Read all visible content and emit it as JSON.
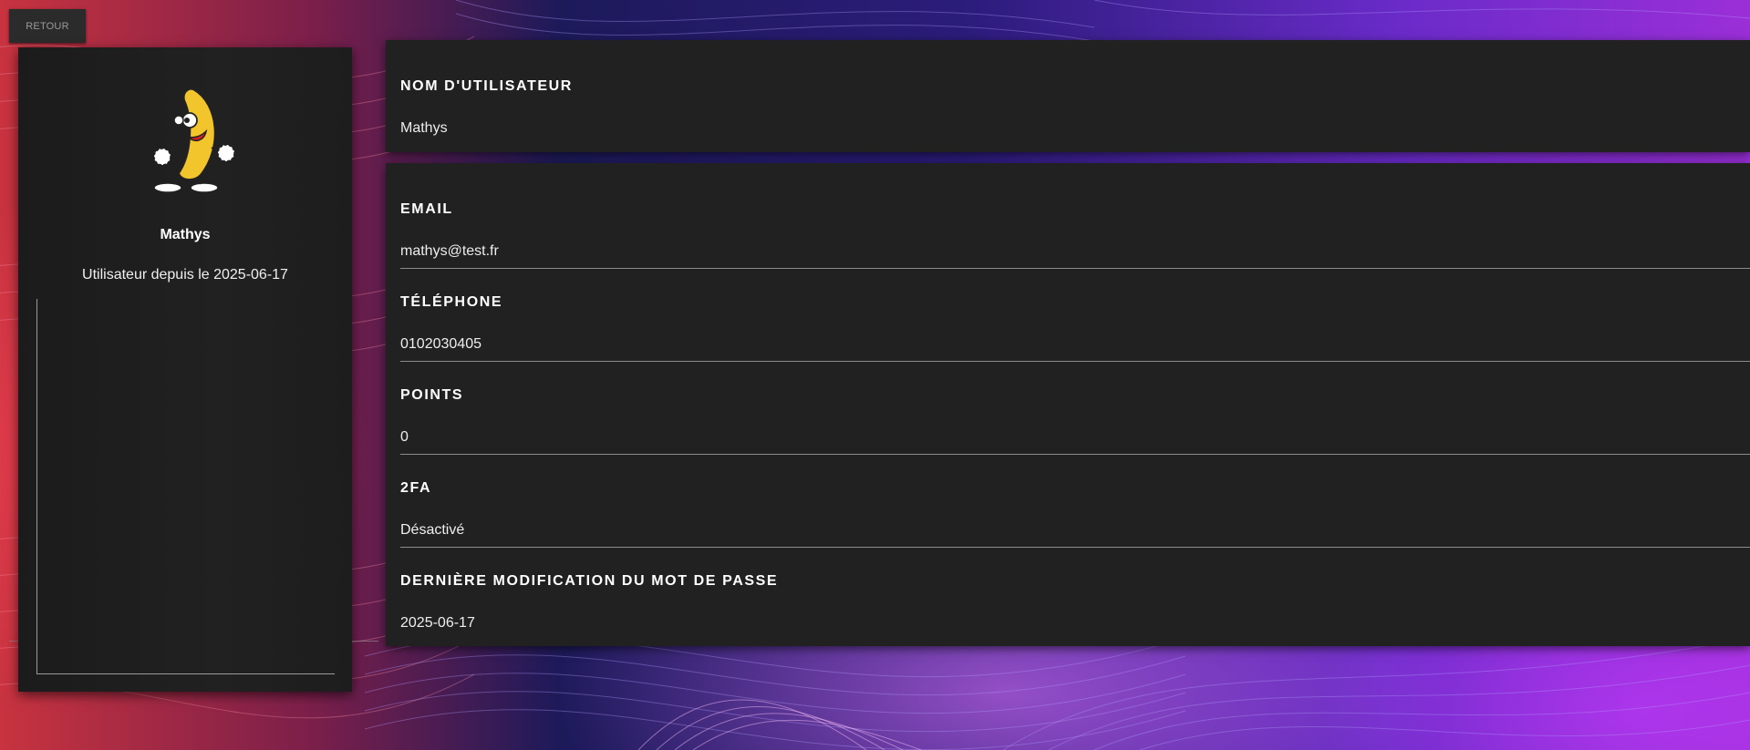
{
  "back_button": {
    "label": "RETOUR"
  },
  "profile": {
    "name": "Mathys",
    "since": "Utilisateur depuis le 2025-06-17",
    "avatar_icon": "dancing-banana-icon"
  },
  "username": {
    "label": "NOM D'UTILISATEUR",
    "value": "Mathys"
  },
  "fields": [
    {
      "label": "EMAIL",
      "value": "mathys@test.fr"
    },
    {
      "label": "TÉLÉPHONE",
      "value": "0102030405"
    },
    {
      "label": "POINTS",
      "value": "0"
    },
    {
      "label": "2FA",
      "value": "Désactivé"
    },
    {
      "label": "DERNIÈRE MODIFICATION DU MOT DE PASSE",
      "value": "2025-06-17"
    }
  ],
  "colors": {
    "card_bg": "#212121",
    "accent_red": "#c8333f",
    "accent_purple": "#9b2fd8"
  }
}
